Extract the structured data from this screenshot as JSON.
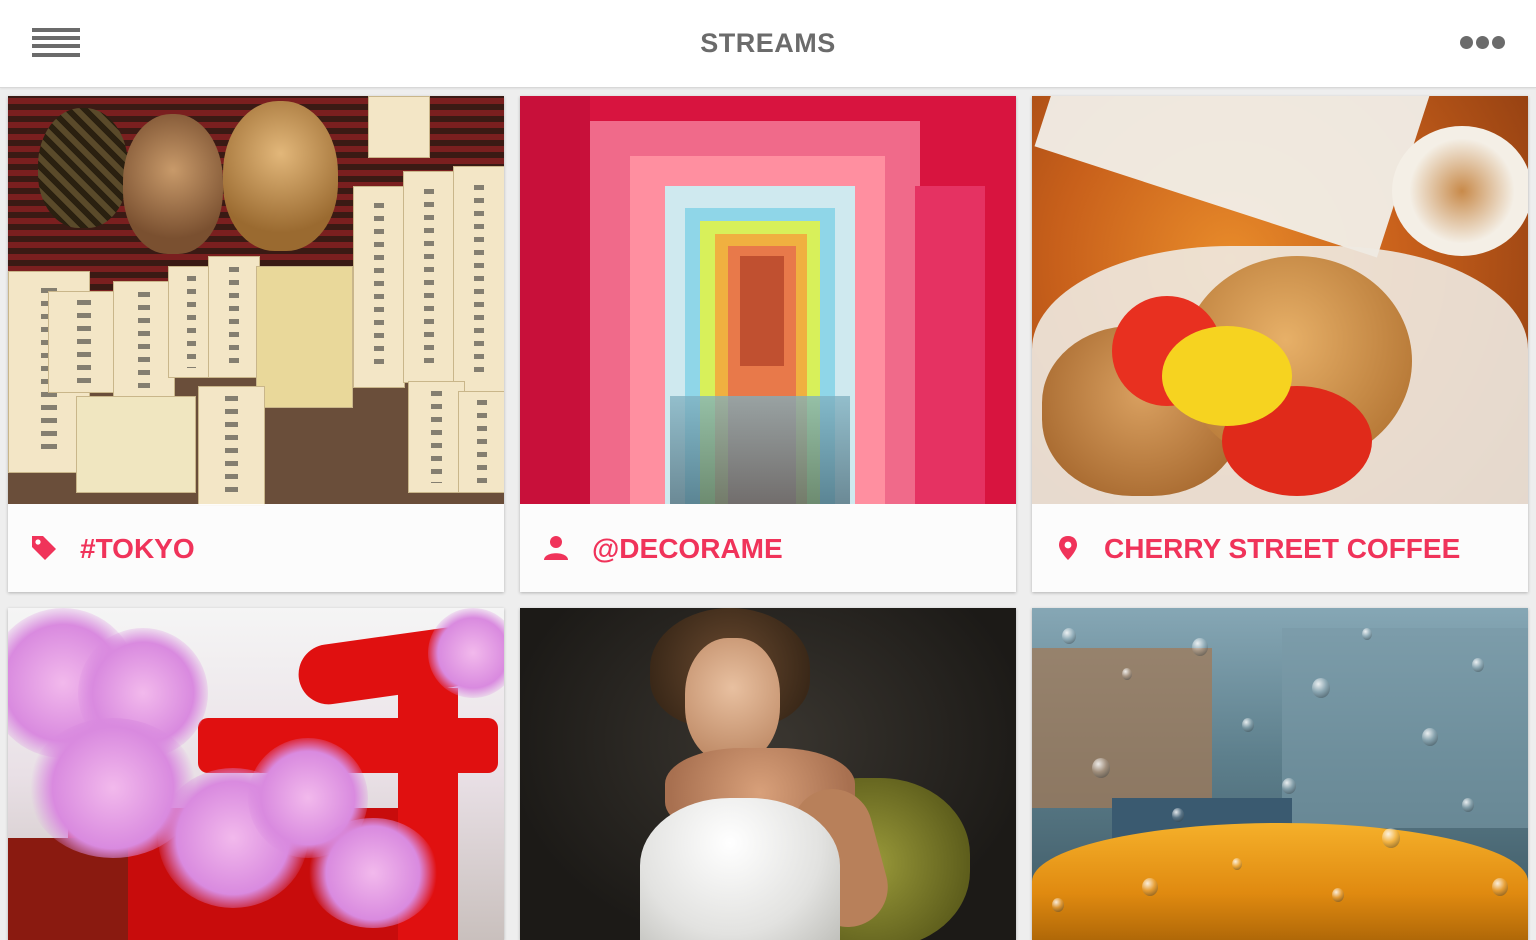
{
  "header": {
    "title": "STREAMS",
    "menu_icon": "hamburger-menu-icon",
    "more_icon": "more-dots-icon"
  },
  "colors": {
    "accent": "#f0335a",
    "header_text": "#6b6b6b",
    "background": "#eeeeee"
  },
  "cards": [
    {
      "label": "#TOKYO",
      "icon": "tag-icon",
      "photo": "tokyo izakaya menu wall"
    },
    {
      "label": "@DECORAME",
      "icon": "user-icon",
      "photo": "neon corridor"
    },
    {
      "label": "CHERRY STREET COFFEE",
      "icon": "location-pin-icon",
      "photo": "bagel sandwich"
    },
    {
      "label": null,
      "icon": null,
      "photo": "torii gate with cherry blossoms"
    },
    {
      "label": null,
      "icon": null,
      "photo": "portrait in white dress"
    },
    {
      "label": null,
      "icon": null,
      "photo": "rain on window with taxi"
    }
  ]
}
